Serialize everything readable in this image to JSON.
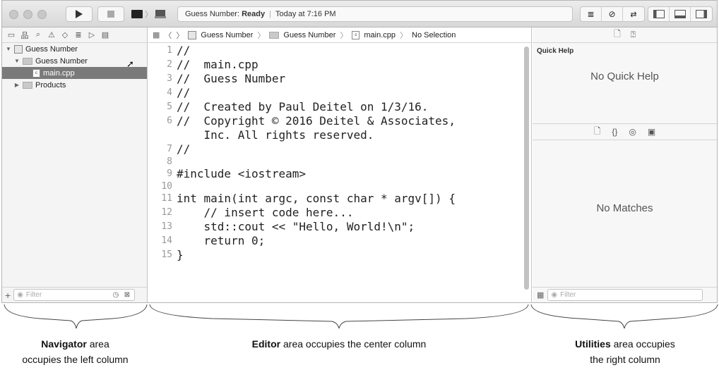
{
  "toolbar": {
    "activity_app": "Guess Number:",
    "activity_status": "Ready",
    "activity_time": "Today at 7:16 PM"
  },
  "navigator": {
    "tree": [
      {
        "label": "Guess Number",
        "kind": "project",
        "expanded": true
      },
      {
        "label": "Guess Number",
        "kind": "folder",
        "expanded": true
      },
      {
        "label": "main.cpp",
        "kind": "file",
        "selected": true
      },
      {
        "label": "Products",
        "kind": "folder",
        "expanded": false
      }
    ],
    "filter_placeholder": "Filter"
  },
  "jumpbar": {
    "crumbs": [
      "Guess Number",
      "Guess Number",
      "main.cpp",
      "No Selection"
    ]
  },
  "editor": {
    "lines": [
      {
        "num": "1",
        "text": "//"
      },
      {
        "num": "2",
        "text": "//  main.cpp"
      },
      {
        "num": "3",
        "text": "//  Guess Number"
      },
      {
        "num": "4",
        "text": "//"
      },
      {
        "num": "5",
        "text": "//  Created by Paul Deitel on 1/3/16."
      },
      {
        "num": "6",
        "text": "//  Copyright © 2016 Deitel & Associates,"
      },
      {
        "num": "",
        "text": "    Inc. All rights reserved."
      },
      {
        "num": "7",
        "text": "//"
      },
      {
        "num": "8",
        "text": ""
      },
      {
        "num": "9",
        "text": "#include <iostream>"
      },
      {
        "num": "10",
        "text": ""
      },
      {
        "num": "11",
        "text": "int main(int argc, const char * argv[]) {"
      },
      {
        "num": "12",
        "text": "    // insert code here..."
      },
      {
        "num": "13",
        "text": "    std::cout << \"Hello, World!\\n\";"
      },
      {
        "num": "14",
        "text": "    return 0;"
      },
      {
        "num": "15",
        "text": "}"
      }
    ]
  },
  "utilities": {
    "quick_help_title": "Quick Help",
    "quick_help_message": "No Quick Help",
    "library_message": "No Matches",
    "filter_placeholder": "Filter"
  },
  "annotations": {
    "navigator": {
      "bold": "Navigator",
      "rest": "area",
      "line2": "occupies the left column"
    },
    "editor": {
      "bold": "Editor",
      "rest": "area occupies the center column"
    },
    "utilities": {
      "bold": "Utilities",
      "rest": "area occupies",
      "line2": "the right column"
    }
  }
}
